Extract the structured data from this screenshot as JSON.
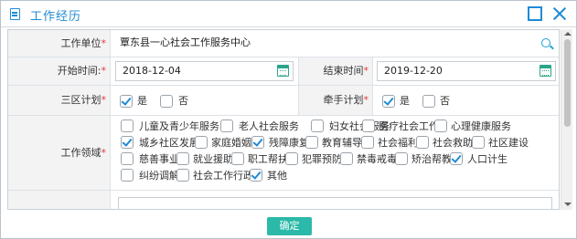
{
  "dialog": {
    "title": "工作经历",
    "title_icon": "document-icon",
    "buttons": {
      "maximize": "maximize-icon",
      "close": "close-icon"
    }
  },
  "form": {
    "work_unit": {
      "label": "工作单位",
      "required_mark": "*",
      "value": "覃东县一心社会工作服务中心",
      "icon": "search-icon"
    },
    "start_time": {
      "label": "开始时间:",
      "required_mark": "*",
      "value": "2018-12-04",
      "icon": "calendar-icon"
    },
    "end_time": {
      "label": "结束时间",
      "required_mark": "*",
      "value": "2019-12-20",
      "icon": "calendar-icon"
    },
    "three_zone_plan": {
      "label": "三区计划",
      "required_mark": "*",
      "options": [
        {
          "label": "是",
          "checked": true
        },
        {
          "label": "否",
          "checked": false
        }
      ]
    },
    "hand_in_hand_plan": {
      "label": "牵手计划",
      "required_mark": "*",
      "options": [
        {
          "label": "是",
          "checked": true
        },
        {
          "label": "否",
          "checked": false
        }
      ]
    },
    "work_field": {
      "label": "工作领域",
      "required_mark": "*",
      "options": [
        {
          "label": "儿童及青少年服务",
          "checked": false
        },
        {
          "label": "老人社会服务",
          "checked": false
        },
        {
          "label": "妇女社会服务",
          "checked": false
        },
        {
          "label": "医疗社会工作",
          "checked": false
        },
        {
          "label": "心理健康服务",
          "checked": false
        },
        {
          "label": "城乡社区发展",
          "checked": true
        },
        {
          "label": "家庭婚姻",
          "checked": false
        },
        {
          "label": "残障康复",
          "checked": true
        },
        {
          "label": "教育辅导",
          "checked": false
        },
        {
          "label": "社会福利",
          "checked": false
        },
        {
          "label": "社会救助",
          "checked": false
        },
        {
          "label": "社区建设",
          "checked": false
        },
        {
          "label": "慈善事业",
          "checked": false
        },
        {
          "label": "就业援助",
          "checked": false
        },
        {
          "label": "职工帮扶",
          "checked": false
        },
        {
          "label": "犯罪预防",
          "checked": false
        },
        {
          "label": "禁毒戒毒",
          "checked": false
        },
        {
          "label": "矫治帮教",
          "checked": false
        },
        {
          "label": "人口计生",
          "checked": true
        },
        {
          "label": "纠纷调解",
          "checked": false
        },
        {
          "label": "社会工作行政",
          "checked": false
        },
        {
          "label": "其他",
          "checked": true
        }
      ]
    }
  },
  "footer": {
    "ok_label": "确定"
  },
  "colors": {
    "accent": "#1f8bd6",
    "ok_button": "#2bb9a9",
    "required": "#e03a3a",
    "label_bg": "#f3f3f3"
  }
}
